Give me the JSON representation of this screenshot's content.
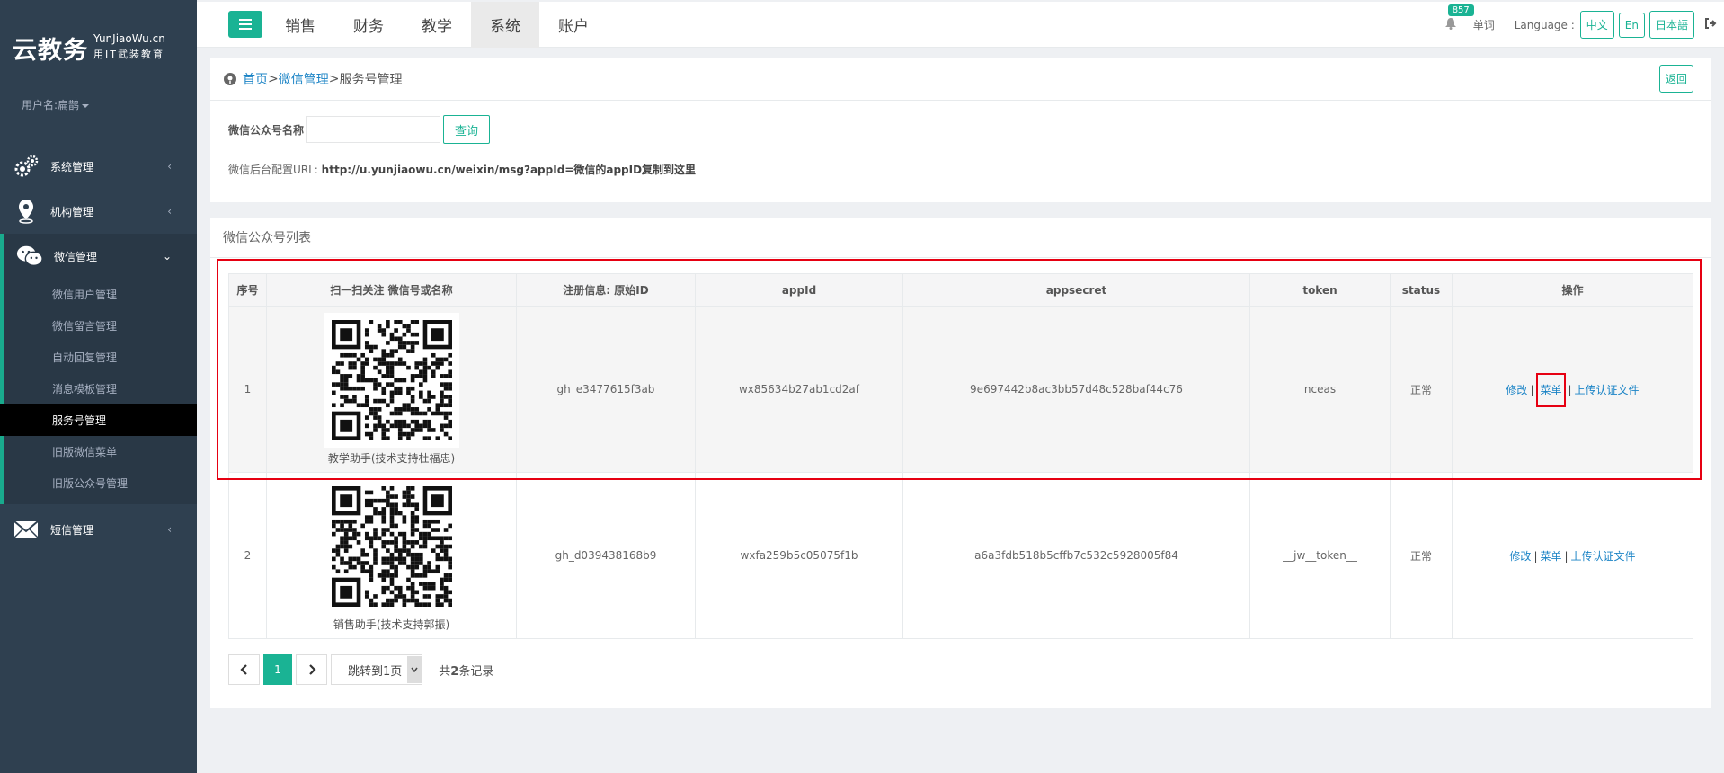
{
  "logo": {
    "main": "云教务",
    "site": "YunJiaoWu.cn",
    "slogan": "用IT武装教育"
  },
  "user": {
    "label": "用户名:扁鹊"
  },
  "sidebar": {
    "items": [
      {
        "label": "系统管理",
        "icon": "gears-icon"
      },
      {
        "label": "机构管理",
        "icon": "map-marker-icon"
      },
      {
        "label": "微信管理",
        "icon": "wechat-icon"
      }
    ],
    "wechat_sub": [
      {
        "label": "微信用户管理"
      },
      {
        "label": "微信留言管理"
      },
      {
        "label": "自动回复管理"
      },
      {
        "label": "消息模板管理"
      },
      {
        "label": "服务号管理"
      },
      {
        "label": "旧版微信菜单"
      },
      {
        "label": "旧版公众号管理"
      }
    ],
    "sms": {
      "label": "短信管理",
      "icon": "envelope-icon"
    }
  },
  "topnav": {
    "items": [
      {
        "label": "销售"
      },
      {
        "label": "财务"
      },
      {
        "label": "教学"
      },
      {
        "label": "系统"
      },
      {
        "label": "账户"
      }
    ],
    "badge": "857",
    "word_label": "单词",
    "language_label": "Language :",
    "langs": [
      {
        "label": "中文"
      },
      {
        "label": "En"
      },
      {
        "label": "日本語"
      }
    ]
  },
  "breadcrumb": {
    "home": "首页",
    "sep1": " >",
    "level2": "微信管理",
    "sep2": " > ",
    "current": "服务号管理",
    "back": "返回"
  },
  "search": {
    "label": "微信公众号名称",
    "value": "",
    "button": "查询"
  },
  "config": {
    "prefix": "微信后台配置URL: ",
    "url": "http://u.yunjiaowu.cn/weixin/msg?appId=微信的appID复制到这里"
  },
  "list": {
    "title": "微信公众号列表",
    "headers": [
      "序号",
      "扫一扫关注 微信号或名称",
      "注册信息: 原始ID",
      "appId",
      "appsecret",
      "token",
      "status",
      "操作"
    ],
    "rows": [
      {
        "no": "1",
        "name": "教学助手(技术支持杜福忠)",
        "origin_id": "gh_e3477615f3ab",
        "appid": "wx85634b27ab1cd2af",
        "appsecret": "9e697442b8ac3bb57d48c528baf44c76",
        "token": "nceas",
        "status": "正常"
      },
      {
        "no": "2",
        "name": "销售助手(技术支持郭振)",
        "origin_id": "gh_d039438168b9",
        "appid": "wxfa259b5c05075f1b",
        "appsecret": "a6a3fdb518b5cffb7c532c5928005f84",
        "token": "__jw__token__",
        "status": "正常"
      }
    ],
    "ops": {
      "edit": "修改",
      "menu": "菜单",
      "upload": "上传认证文件",
      "sep": "|"
    }
  },
  "pager": {
    "current": "1",
    "jump": "跳转到1页",
    "total_prefix": "共",
    "total_count": "2",
    "total_suffix": "条记录"
  },
  "colors": {
    "accent": "#1ab394",
    "sidebar": "#2f4050",
    "link": "#1c84c6",
    "highlight": "#e60012"
  }
}
